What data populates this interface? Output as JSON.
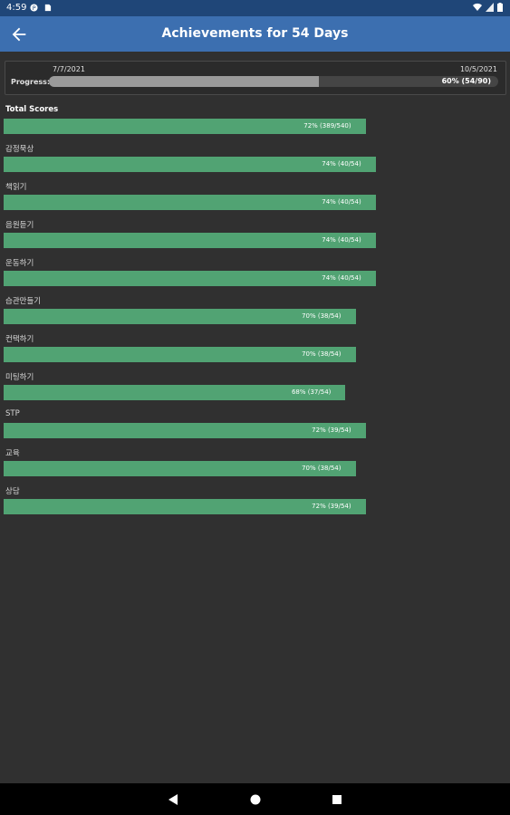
{
  "status_bar": {
    "time": "4:59"
  },
  "app_bar": {
    "title": "Achievements for 54 Days"
  },
  "progress": {
    "start_date": "7/7/2021",
    "end_date": "10/5/2021",
    "label": "Progress:",
    "text": "60% (54/90)",
    "fraction": 0.6
  },
  "rows": [
    {
      "label": "Total Scores",
      "text": "72% (389/540)",
      "fraction": 0.72,
      "total": true
    },
    {
      "label": "감정묵상",
      "text": "74% (40/54)",
      "fraction": 0.74
    },
    {
      "label": "책읽기",
      "text": "74% (40/54)",
      "fraction": 0.74
    },
    {
      "label": "음원듣기",
      "text": "74% (40/54)",
      "fraction": 0.74
    },
    {
      "label": "운동하기",
      "text": "74% (40/54)",
      "fraction": 0.74
    },
    {
      "label": "습관만들기",
      "text": "70% (38/54)",
      "fraction": 0.7
    },
    {
      "label": "컨택하기",
      "text": "70% (38/54)",
      "fraction": 0.7
    },
    {
      "label": "미팅하기",
      "text": "68% (37/54)",
      "fraction": 0.68
    },
    {
      "label": "STP",
      "text": "72% (39/54)",
      "fraction": 0.72
    },
    {
      "label": "교육",
      "text": "70% (38/54)",
      "fraction": 0.7
    },
    {
      "label": "상담",
      "text": "72% (39/54)",
      "fraction": 0.72
    }
  ],
  "colors": {
    "app_bar": "#3c6fb0",
    "bar": "#51a373",
    "background": "#303030"
  }
}
